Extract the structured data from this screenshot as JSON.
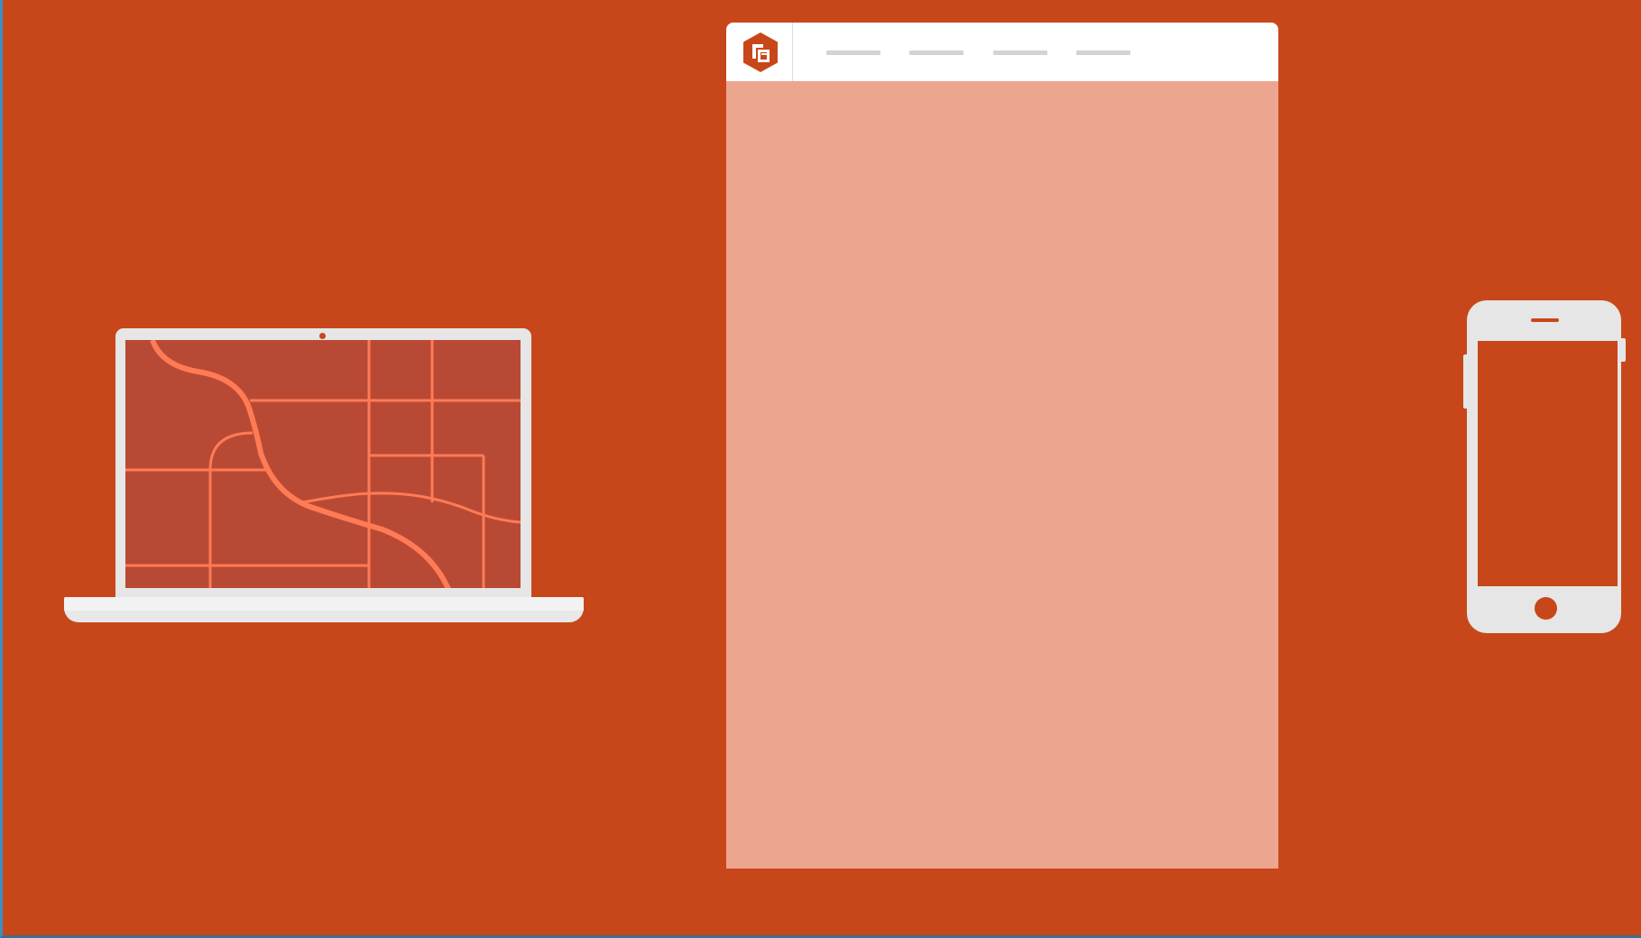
{
  "theme": {
    "background": "#c8471a",
    "device_frame": "#e6e6e6",
    "laptop_screen": "#b84a35",
    "map_roads": "#ff7b55",
    "page_body": "#eca58f",
    "page_header": "#ffffff",
    "nav_placeholder": "#d3d3d3"
  },
  "laptop": {
    "icon": "laptop-icon",
    "screen_content": "map-illustration"
  },
  "page": {
    "logo_icon": "app-logo-icon",
    "nav_items": [
      {
        "icon": "nav-placeholder-line"
      },
      {
        "icon": "nav-placeholder-line"
      },
      {
        "icon": "nav-placeholder-line"
      },
      {
        "icon": "nav-placeholder-line"
      }
    ]
  },
  "phone": {
    "icon": "smartphone-icon"
  }
}
